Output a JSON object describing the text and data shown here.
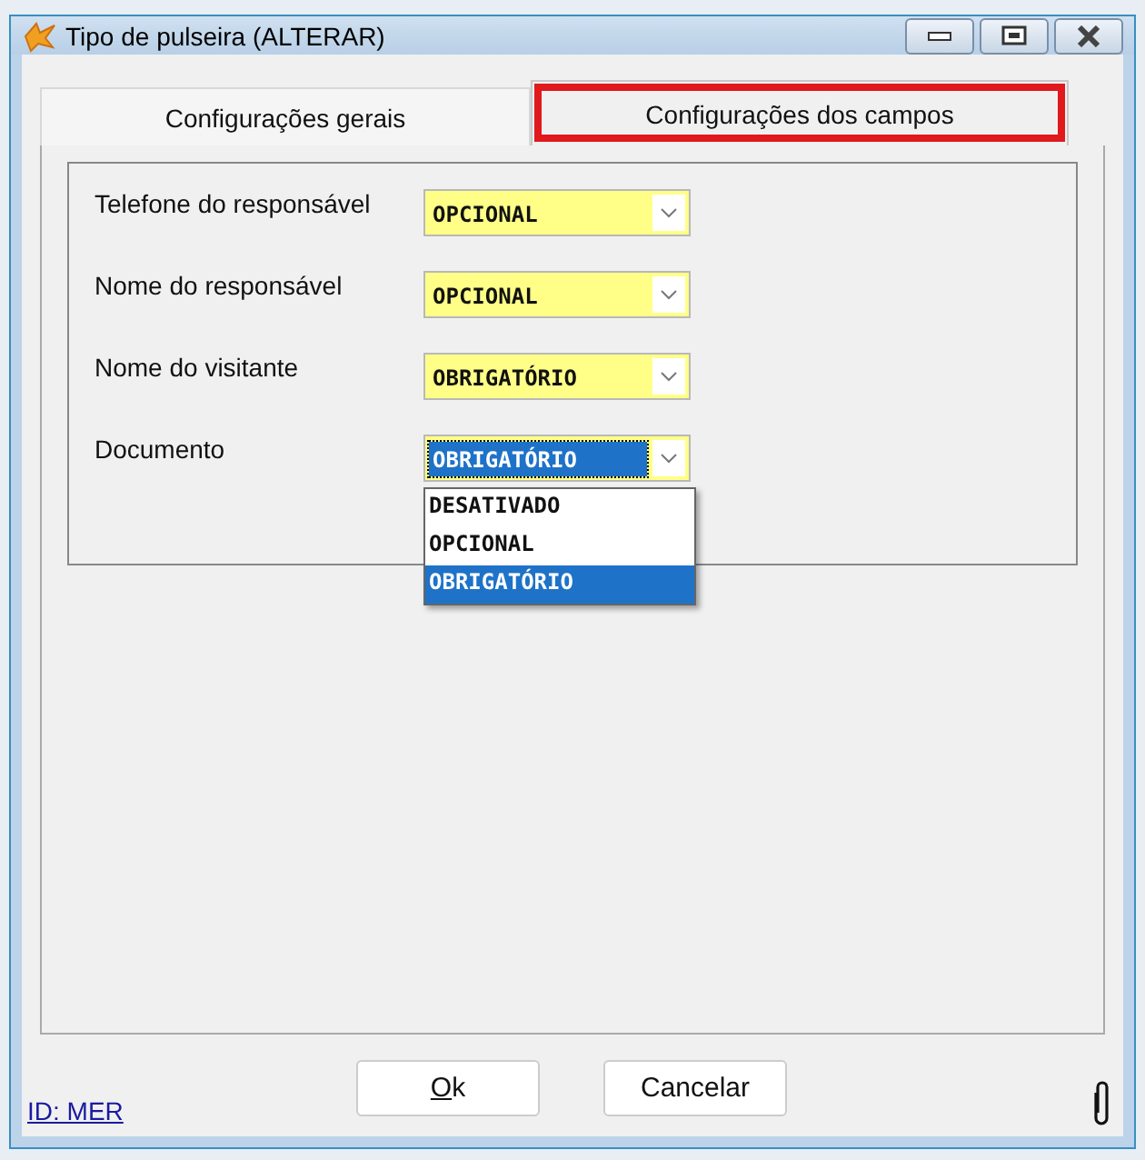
{
  "window": {
    "title": "Tipo de pulseira (ALTERAR)"
  },
  "tabs": [
    {
      "label": "Configurações gerais",
      "selected": false,
      "highlighted": false
    },
    {
      "label": "Configurações dos campos",
      "selected": true,
      "highlighted": true
    }
  ],
  "fields": [
    {
      "label": "Telefone do responsável",
      "value": "OPCIONAL",
      "focused": false
    },
    {
      "label": "Nome do responsável",
      "value": "OPCIONAL",
      "focused": false
    },
    {
      "label": "Nome do visitante",
      "value": "OBRIGATÓRIO",
      "focused": false
    },
    {
      "label": "Documento",
      "value": "OBRIGATÓRIO",
      "focused": true
    }
  ],
  "dropdown": {
    "options": [
      {
        "label": "DESATIVADO",
        "selected": false
      },
      {
        "label": "OPCIONAL",
        "selected": false
      },
      {
        "label": "OBRIGATÓRIO",
        "selected": true
      }
    ]
  },
  "buttons": [
    {
      "label": "Ok",
      "mnemonic_underlined": true
    },
    {
      "label": "Cancelar"
    }
  ],
  "id_link": "ID: MER"
}
